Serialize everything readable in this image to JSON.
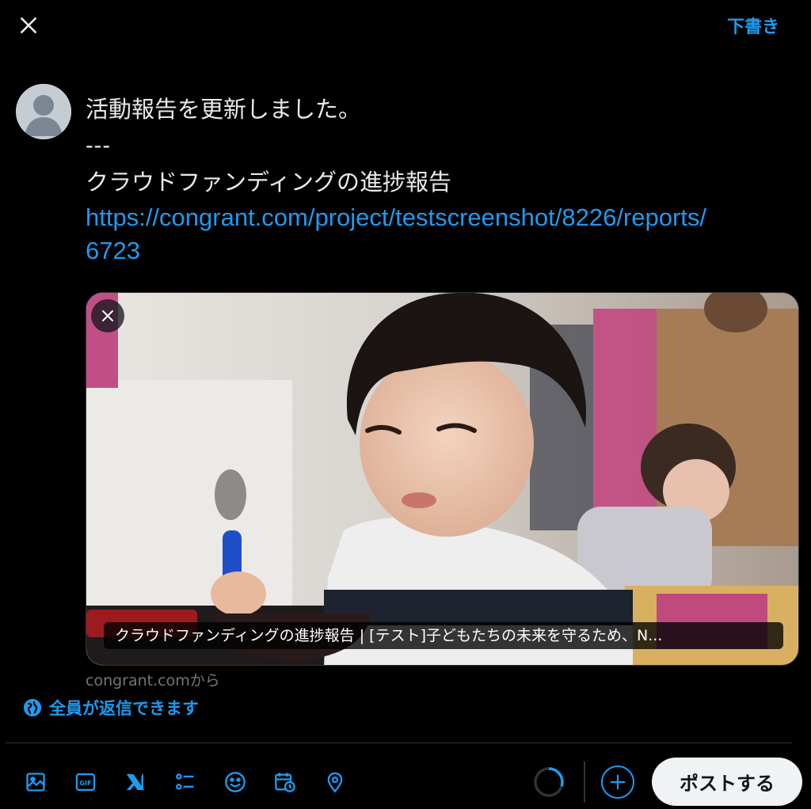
{
  "header": {
    "close_icon": "close-icon",
    "drafts_label": "下書き"
  },
  "composer": {
    "avatar_icon": "default-avatar-icon",
    "line1": "活動報告を更新しました。",
    "line2": "---",
    "line3": "クラウドファンディングの進捗報告",
    "url_part1": "https://congrant.com/project/testscreenshot/8226/reports/",
    "url_part2": "6723"
  },
  "link_card": {
    "title": "クラウドファンディングの進捗報告 | [テスト]子どもたちの未来を守るため、N...",
    "source": "congrant.comから",
    "remove_icon": "close-icon",
    "image_icon": "child-eating-photo"
  },
  "reply_setting": {
    "label": "全員が返信できます",
    "icon": "globe-icon"
  },
  "toolbar": {
    "tools": [
      "image-icon",
      "gif-icon",
      "grok-icon",
      "poll-icon",
      "emoji-icon",
      "schedule-icon",
      "location-icon"
    ],
    "add_icon": "plus-icon",
    "post_label": "ポストする"
  },
  "colors": {
    "accent": "#1d9bf0",
    "background": "#000000",
    "text": "#e7e9ea",
    "muted": "#71767b",
    "post_button_bg": "#eff3f4"
  }
}
